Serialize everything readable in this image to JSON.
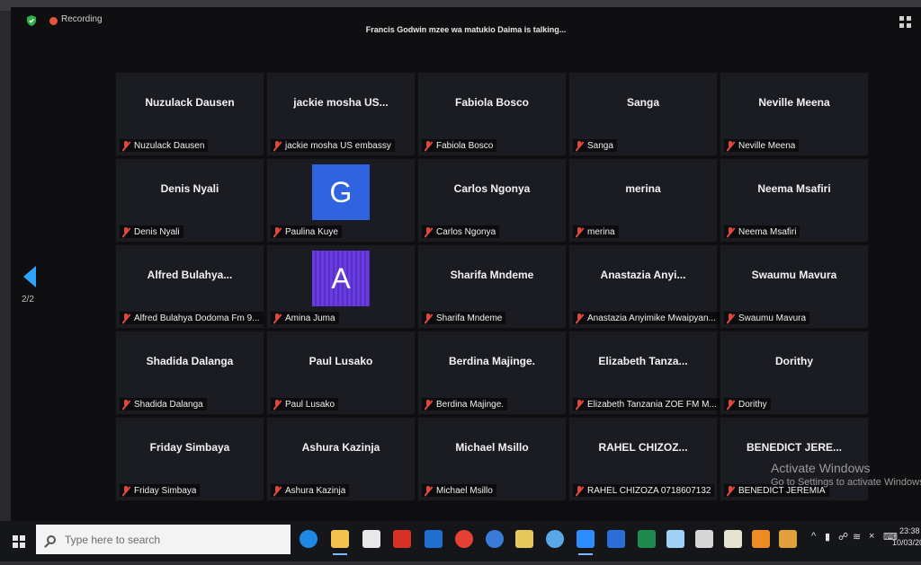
{
  "topbar": {
    "recording_label": "Recording",
    "active_speaker": "Francis Godwin mzee  wa  matukio Daima is talking..."
  },
  "navigation": {
    "page_indicator": "2/2"
  },
  "tiles": [
    {
      "title": "Nuzulack Dausen",
      "name": "Nuzulack Dausen"
    },
    {
      "title": "jackie  mosha US...",
      "name": "jackie mosha US embassy"
    },
    {
      "title": "Fabiola Bosco",
      "name": "Fabiola Bosco"
    },
    {
      "title": "Sanga",
      "name": "Sanga"
    },
    {
      "title": "Neville Meena",
      "name": "Neville Meena"
    },
    {
      "title": "Denis Nyali",
      "name": "Denis Nyali"
    },
    {
      "title": "",
      "avatar": "G",
      "name": "Paulina Kuye"
    },
    {
      "title": "Carlos Ngonya",
      "name": "Carlos Ngonya"
    },
    {
      "title": "merina",
      "name": "merina"
    },
    {
      "title": "Neema Msafiri",
      "name": "Neema Msafiri"
    },
    {
      "title": "Alfred  Bulahya...",
      "name": "Alfred Bulahya Dodoma Fm 9..."
    },
    {
      "title": "",
      "avatar": "A",
      "name": "Amina Juma"
    },
    {
      "title": "Sharifa Mndeme",
      "name": "Sharifa Mndeme"
    },
    {
      "title": "Anastazia  Anyi...",
      "name": "Anastazia Anyimike Mwaipyan..."
    },
    {
      "title": "Swaumu Mavura",
      "name": "Swaumu Mavura"
    },
    {
      "title": "Shadida Dalanga",
      "name": "Shadida Dalanga"
    },
    {
      "title": "Paul Lusako",
      "name": "Paul Lusako"
    },
    {
      "title": "Berdina Majinge.",
      "name": "Berdina Majinge."
    },
    {
      "title": "Elizabeth  Tanza...",
      "name": "Elizabeth Tanzania ZOE FM M..."
    },
    {
      "title": "Dorithy",
      "name": "Dorithy"
    },
    {
      "title": "Friday Simbaya",
      "name": "Friday Simbaya"
    },
    {
      "title": "Ashura Kazinja",
      "name": "Ashura Kazinja"
    },
    {
      "title": "Michael Msillo",
      "name": "Michael Msillo"
    },
    {
      "title": "RAHEL  CHIZOZ...",
      "name": "RAHEL CHIZOZA 0718607132"
    },
    {
      "title": "BENEDICT  JERE...",
      "name": "BENEDICT JEREMIA"
    }
  ],
  "watermark": {
    "line1": "Activate Windows",
    "line2": "Go to Settings to activate Windows."
  },
  "taskbar": {
    "search_placeholder": "Type here to search",
    "time": "23:38",
    "date": "10/03/20"
  },
  "colors": {
    "accent_blue": "#2ea3ff",
    "avatar_g": "#2f63e0",
    "avatar_a": "#6a3be0",
    "mute_red": "#e14b3b",
    "recording_red": "#e5533d"
  }
}
